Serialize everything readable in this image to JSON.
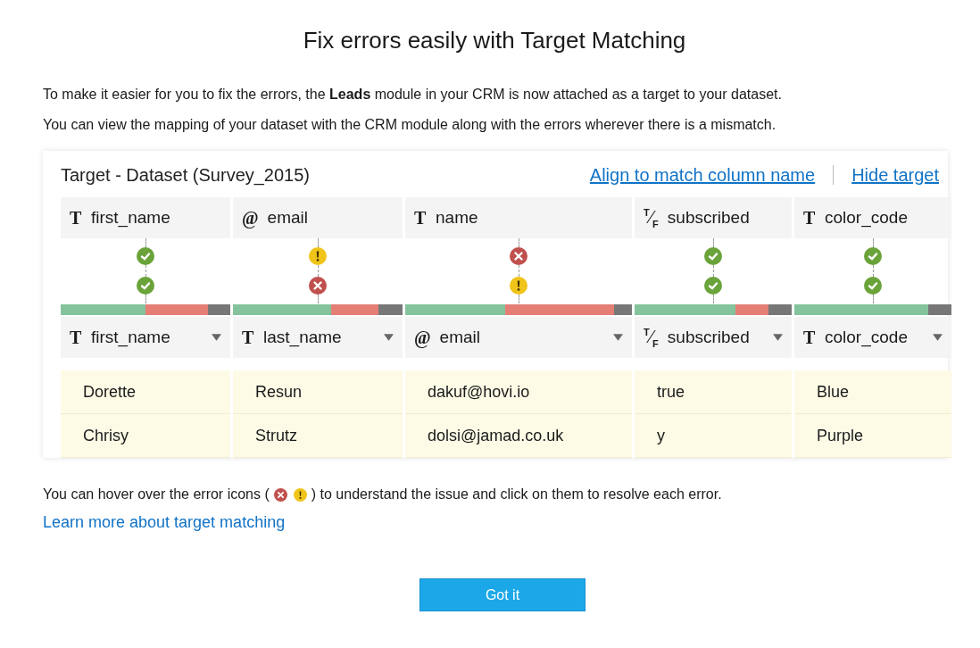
{
  "title": "Fix errors easily with Target Matching",
  "intro": [
    "To make it easier for you to fix the errors, the **Leads** module in your CRM is now attached as a target to your dataset.",
    "You can view the mapping of your dataset with the CRM module along with the errors wherever there is a mismatch."
  ],
  "panel": {
    "title": "Target - Dataset (Survey_2015)",
    "links": [
      "Align to match column name",
      "Hide target"
    ],
    "target_columns": [
      {
        "type_glyph": "T",
        "name": "first_name"
      },
      {
        "type_glyph": "@",
        "name": "email"
      },
      {
        "type_glyph": "T",
        "name": "name"
      },
      {
        "type_glyph": "$^{T}$⁄$_{F}$",
        "name": "subscribed"
      },
      {
        "type_glyph": "T",
        "name": "color_code"
      }
    ],
    "mappings": [
      {
        "checks": [
          {
            "kind": "ok"
          },
          {
            "kind": "ok"
          }
        ]
      },
      {
        "checks": [
          {
            "kind": "warning"
          },
          {
            "kind": "error"
          }
        ]
      },
      {
        "checks": [
          {
            "kind": "error"
          },
          {
            "kind": "warning"
          }
        ]
      },
      {
        "checks": [
          {
            "kind": "ok"
          },
          {
            "kind": "ok"
          }
        ]
      },
      {
        "checks": [
          {
            "kind": "ok"
          },
          {
            "kind": "ok"
          }
        ]
      }
    ],
    "quality_bars": [
      {
        "fills": [
          {
            "kind": "filled",
            "level": 0.87
          },
          {
            "kind": "valid",
            "level": 0.5
          }
        ]
      },
      {
        "fills": [
          {
            "kind": "filled",
            "level": 0.86
          },
          {
            "kind": "valid",
            "level": 0.58
          }
        ]
      },
      {
        "fills": [
          {
            "kind": "filled",
            "level": 0.92
          },
          {
            "kind": "valid",
            "level": 0.44
          }
        ]
      },
      {
        "fills": [
          {
            "kind": "filled",
            "level": 0.85
          },
          {
            "kind": "valid",
            "level": 0.64
          }
        ]
      },
      {
        "fills": [
          {
            "kind": "valid",
            "level": 0.85
          }
        ]
      }
    ],
    "source_columns": [
      {
        "type_glyph": "T",
        "name": "first_name"
      },
      {
        "type_glyph": "T",
        "name": "last_name"
      },
      {
        "type_glyph": "@",
        "name": "email"
      },
      {
        "type_glyph": "$^{T}$⁄$_{F}$",
        "name": "subscribed"
      },
      {
        "type_glyph": "T",
        "name": "color_code"
      }
    ],
    "rows": [
      [
        "Dorette",
        "Resun",
        "dakuf@hovi.io",
        "true",
        "Blue"
      ],
      [
        "Chrisy",
        "Strutz",
        "dolsi@jamad.co.uk",
        "y",
        "Purple"
      ]
    ]
  },
  "hint": {
    "before": "You can hover over the error icons (",
    "icons": [
      {
        "kind": "error"
      },
      {
        "kind": "warning"
      }
    ],
    "after": ") to understand the issue and click on them to resolve each error."
  },
  "learn_more": "Learn more about target matching",
  "button": "Got it"
}
